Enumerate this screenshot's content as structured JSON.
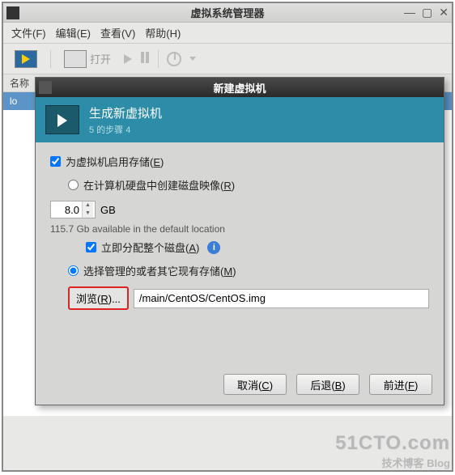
{
  "main": {
    "title": "虚拟系统管理器",
    "menu": {
      "file": "文件(F)",
      "edit": "编辑(E)",
      "view": "查看(V)",
      "help": "帮助(H)"
    },
    "toolbar": {
      "open": "打开"
    },
    "columns": {
      "name": "名称"
    },
    "rows": [
      "lo"
    ]
  },
  "dialog": {
    "title": "新建虚拟机",
    "header": {
      "title": "生成新虚拟机",
      "step": "5 的步骤 4"
    },
    "enable_storage": {
      "label_pre": "为虚拟机启用存储(",
      "key": "E",
      "label_post": ")",
      "checked": true
    },
    "create_disk": {
      "label_pre": "在计算机硬盘中创建磁盘映像(",
      "key": "R",
      "label_post": ")",
      "selected": false
    },
    "size": {
      "value": "8.0",
      "unit": "GB"
    },
    "available": "115.7 Gb available in the default location",
    "allocate": {
      "label_pre": "立即分配整个磁盘(",
      "key": "A",
      "label_post": ")",
      "checked": true
    },
    "select_managed": {
      "label_pre": "选择管理的或者其它现有存储(",
      "key": "M",
      "label_post": ")",
      "selected": true
    },
    "browse": {
      "label_pre": "浏览(",
      "key": "R",
      "label_post": ")..."
    },
    "path": "/main/CentOS/CentOS.img",
    "buttons": {
      "cancel": {
        "pre": "取消(",
        "key": "C",
        "post": ")"
      },
      "back": {
        "pre": "后退(",
        "key": "B",
        "post": ")"
      },
      "forward": {
        "pre": "前进(",
        "key": "F",
        "post": ")"
      }
    }
  },
  "watermark": {
    "l1": "51CTO.com",
    "l2": "技术博客  Blog"
  }
}
